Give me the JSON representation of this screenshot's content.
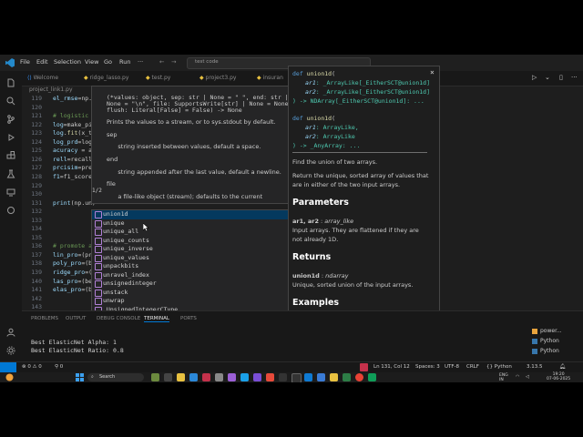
{
  "window": {
    "menu": [
      "File",
      "Edit",
      "Selection",
      "View",
      "Go",
      "Run"
    ],
    "menu_more": "···",
    "search_text": "test code",
    "nav_back": "←",
    "nav_forward": "→"
  },
  "tabs": [
    {
      "label": "Welcome"
    },
    {
      "label": "ridge_lasso.py"
    },
    {
      "label": "test.py"
    },
    {
      "label": "project3.py"
    },
    {
      "label": "insuran"
    }
  ],
  "breadcrumb": "project_link1.py",
  "editor": {
    "lines": [
      {
        "n": "119",
        "code": "el_rmse=np."
      },
      {
        "n": "120",
        "code": ""
      },
      {
        "n": "121",
        "code": "# logistic"
      },
      {
        "n": "122",
        "code": "log=make_pi"
      },
      {
        "n": "123",
        "code": "log.fit(x_t"
      },
      {
        "n": "124",
        "code": "log_prd=log"
      },
      {
        "n": "125",
        "code": "acuracy = a"
      },
      {
        "n": "126",
        "code": "rell=recall"
      },
      {
        "n": "127",
        "code": "prcisim=pre"
      },
      {
        "n": "128",
        "code": "f1=f1_score"
      },
      {
        "n": "129",
        "code": ""
      },
      {
        "n": "130",
        "code": ""
      },
      {
        "n": "131",
        "code": "print(np.un)"
      },
      {
        "n": "132",
        "code": ""
      },
      {
        "n": "133",
        "code": ""
      },
      {
        "n": "134",
        "code": ""
      },
      {
        "n": "135",
        "code": ""
      },
      {
        "n": "136",
        "code": "# promote a"
      },
      {
        "n": "137",
        "code": "lin_pro=(pr"
      },
      {
        "n": "138",
        "code": "poly_pro=(b"
      },
      {
        "n": "139",
        "code": "ridge_pro=("
      },
      {
        "n": "140",
        "code": "las_pro=(be"
      },
      {
        "n": "141",
        "code": "elas_pro=(b"
      },
      {
        "n": "142",
        "code": ""
      },
      {
        "n": "143",
        "code": ""
      }
    ]
  },
  "signature_help": {
    "lines": [
      "(*values: object, sep: str | None = \" \", end: str |",
      "None = \"\\n\", file: SupportsWrite[str] | None = None,",
      "flush: Literal[False] = False) -> None",
      "",
      "Prints the values to a stream, or to sys.stdout by default.",
      "",
      "sep",
      "",
      "      string inserted between values, default a space.",
      "",
      "end",
      "",
      "      string appended after the last value, default a newline.",
      "",
      "file",
      "",
      "      a file-like object (stream); defaults to the current"
    ],
    "counter": "1/2"
  },
  "suggestions": [
    "union1d",
    "unique",
    "unique_all",
    "unique_counts",
    "unique_inverse",
    "unique_values",
    "unpackbits",
    "unravel_index",
    "unsignedinteger",
    "unstack",
    "unwrap",
    "_UnsignedIntegerCType"
  ],
  "selected_suggestion": 0,
  "docs": {
    "sig1": {
      "def": "def",
      "name": "union1d",
      "open": "(",
      "p1": "ar1",
      "t1": ": _ArrayLike[_EitherSCT@union1d]",
      "p2": "ar2",
      "t2": ": _ArrayLike[_EitherSCT@union1d]",
      "ret": ") -> NDArray[_EitherSCT@union1d]: ..."
    },
    "sig2": {
      "def": "def",
      "name": "union1d",
      "open": "(",
      "p1": "ar1",
      "t1": ": ArrayLike,",
      "p2": "ar2",
      "t2": ": ArrayLike",
      "ret": ") -> _AnyArray: ..."
    },
    "summary": "Find the union of two arrays.",
    "desc1": "Return the unique, sorted array of values that",
    "desc2": "are in either of the two input arrays.",
    "h_params": "Parameters",
    "param_name": "ar1, ar2",
    "param_type": "array_like",
    "param_desc1": "Input arrays. They are flattened if they are",
    "param_desc2": "not already 1D.",
    "h_returns": "Returns",
    "ret_name": "union1d",
    "ret_type": "ndarray",
    "ret_desc": "Unique, sorted union of the input arrays.",
    "h_examples": "Examples",
    "close": "×"
  },
  "panel": {
    "tabs": [
      "PROBLEMS",
      "OUTPUT",
      "DEBUG CONSOLE",
      "TERMINAL",
      "PORTS"
    ],
    "active_tab": 3,
    "terminal": [
      "Best ElasticNet Alpha: 1",
      "Best ElasticNet Ratio: 0.8"
    ],
    "sessions": [
      "power...",
      "Python",
      "Python"
    ]
  },
  "statusbar": {
    "errors": "0",
    "warnings": "0",
    "left_extra": "0",
    "position": "Ln 131, Col 12",
    "spaces": "Spaces: 3",
    "encoding": "UTF-8",
    "eol": "CRLF",
    "language": "Python",
    "version": "3.13.5"
  },
  "taskbar": {
    "search": "Search",
    "time": "19:20",
    "date": "07-06-2025",
    "lang1": "ENG",
    "lang2": "IN"
  },
  "colors": {
    "accent": "#0078d4",
    "selection": "#04395e",
    "keyword": "#569cd6",
    "function": "#dcdcaa",
    "param": "#9cdcfe",
    "type": "#4ec9b0"
  }
}
